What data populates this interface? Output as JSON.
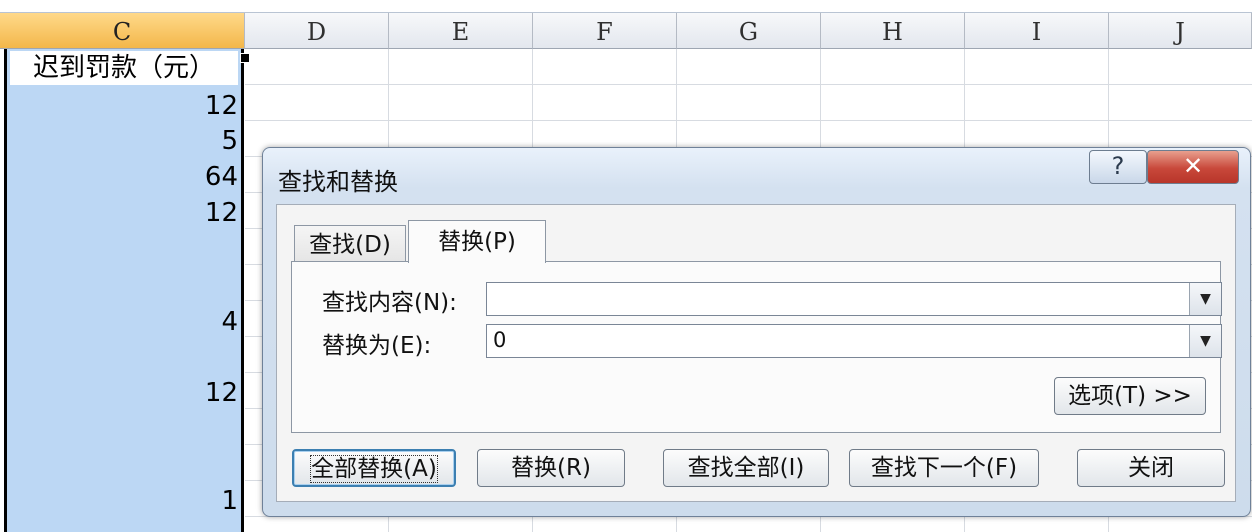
{
  "sheet": {
    "columns": [
      "C",
      "D",
      "E",
      "F",
      "G",
      "H",
      "I",
      "J"
    ],
    "selected_column": "C",
    "column_c_header": "迟到罚款（元）",
    "column_c_values": [
      "12",
      "5",
      "64",
      "12",
      "4",
      "12",
      "1"
    ]
  },
  "dialog": {
    "title": "查找和替换",
    "help_icon": "?",
    "close_icon": "✕",
    "tabs": [
      {
        "label": "查找(D)",
        "active": false
      },
      {
        "label": "替换(P)",
        "active": true
      }
    ],
    "find_label": "查找内容(N):",
    "find_value": "",
    "replace_label": "替换为(E):",
    "replace_value": "0",
    "options_button": "选项(T) >>",
    "buttons": {
      "replace_all": "全部替换(A)",
      "replace": "替换(R)",
      "find_all": "查找全部(I)",
      "find_next": "查找下一个(F)",
      "close": "关闭"
    }
  },
  "colors": {
    "selection": "#bcd7f4",
    "active_column_header": "#f3b74a",
    "close_button": "#c8483a"
  }
}
